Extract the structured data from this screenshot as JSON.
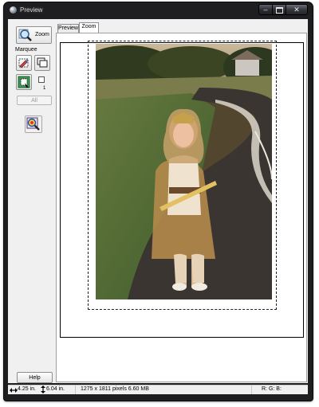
{
  "window": {
    "title": "Preview"
  },
  "toolbar": {
    "zoom_label": "Zoom",
    "marquee_label": "Marquee",
    "marquee_count": "1",
    "all_label": "All",
    "help_label": "Help"
  },
  "tabs": [
    {
      "label": "Preview",
      "active": false
    },
    {
      "label": "Zoom",
      "active": true
    }
  ],
  "status": {
    "width": "4.25 in.",
    "height": "6.04 in.",
    "pixels": "1275 x 1811 pixels 6.60 MB",
    "rgb": "R: G: B:"
  }
}
